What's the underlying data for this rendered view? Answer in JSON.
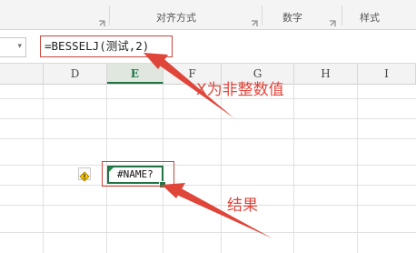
{
  "ribbon": {
    "groups": [
      {
        "label": "对齐方式",
        "launcher_icon": "dialog-launcher-icon"
      },
      {
        "label": "数字",
        "launcher_icon": "dialog-launcher-icon"
      },
      {
        "label": "样式",
        "launcher_icon": ""
      }
    ]
  },
  "formula_bar": {
    "formula": "=BESSELJ(测试,2)"
  },
  "columns": [
    "D",
    "E",
    "F",
    "G",
    "H",
    "I"
  ],
  "selected_column": "E",
  "active_cell": {
    "value": "#NAME?",
    "error_icon": "warning-icon"
  },
  "annotations": {
    "x_not_integer": "X为非整数值",
    "result": "结果"
  },
  "colors": {
    "annotation_red": "#e0453a",
    "excel_green": "#217346",
    "warning_yellow": "#f2c200"
  }
}
